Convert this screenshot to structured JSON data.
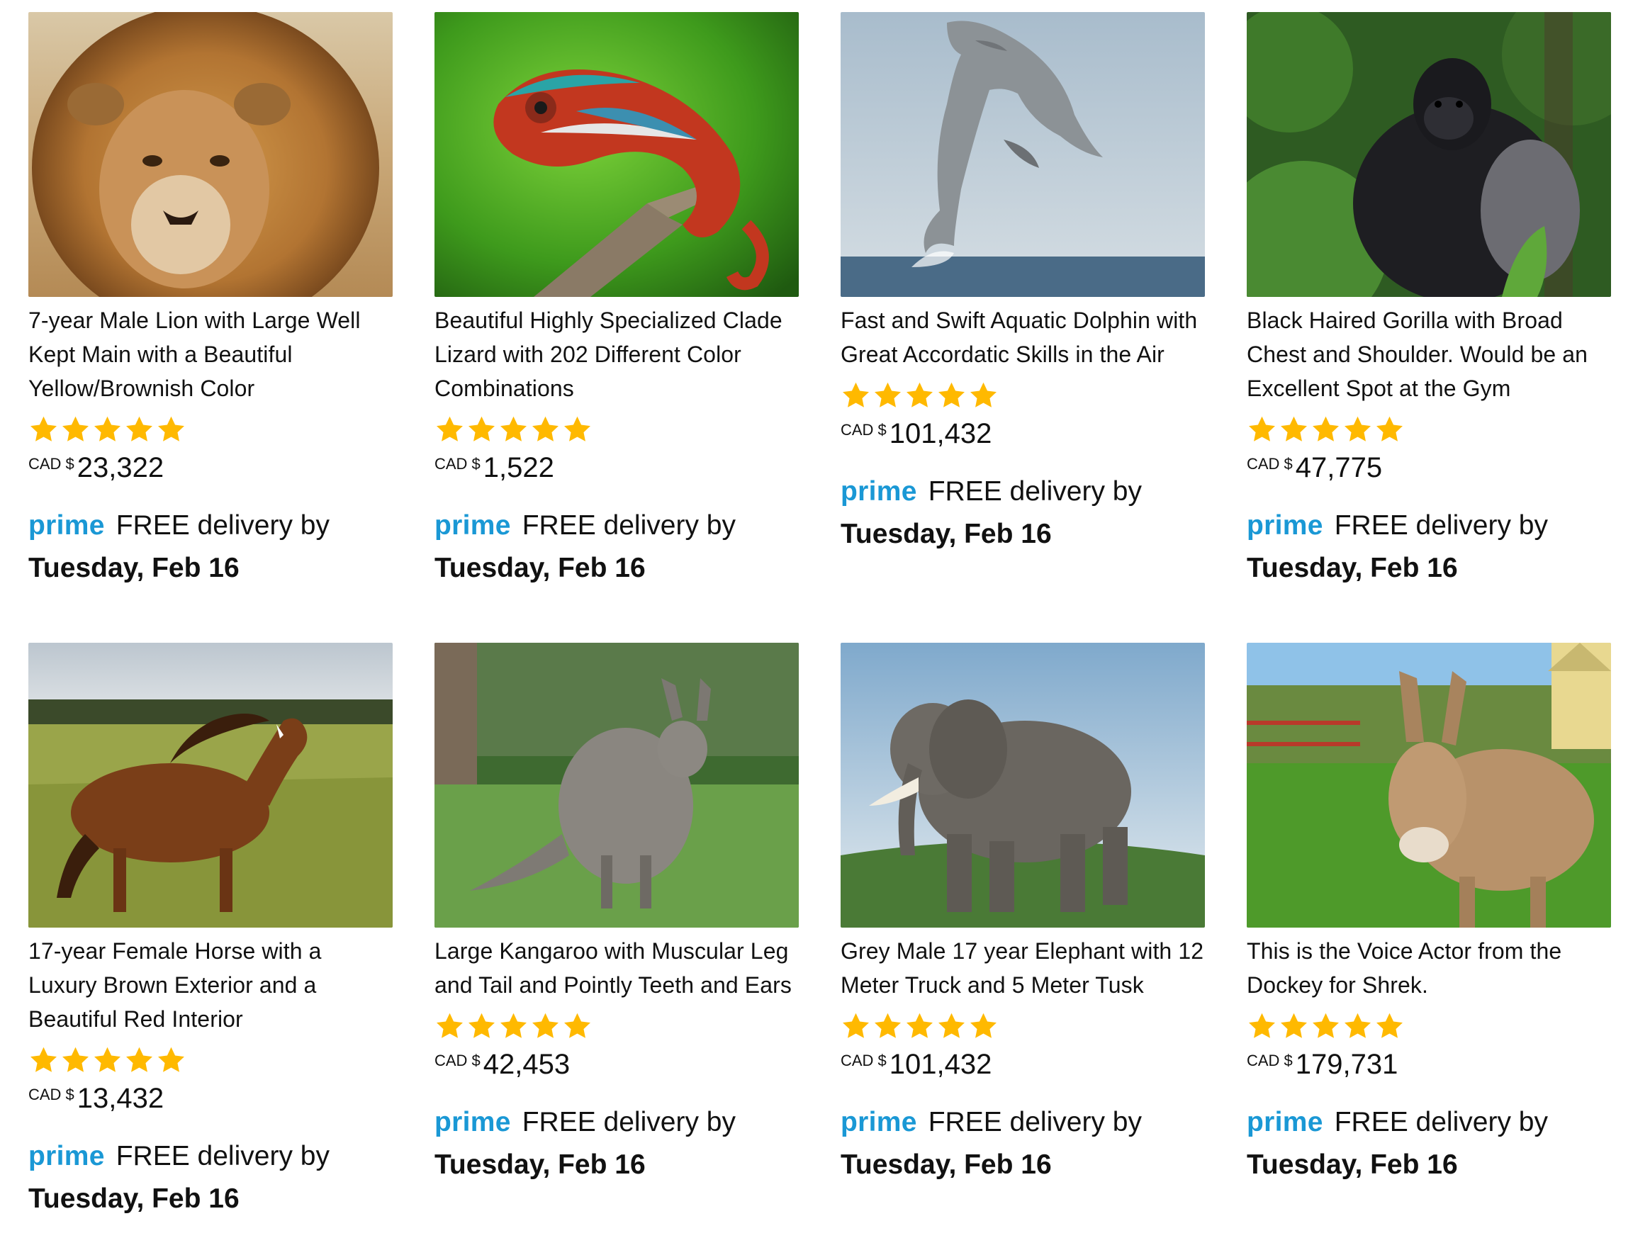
{
  "colors": {
    "prime_blue": "#1a98d5",
    "star_gold": "#ffb900",
    "text": "#111111"
  },
  "icons": {
    "rating": "star-icon"
  },
  "products": [
    {
      "image_alt": "lion",
      "title": "7-year Male Lion with Large Well Kept Main with a Beautiful Yellow/Brownish Color",
      "rating": 5,
      "currency": "CAD $",
      "price": "23,322",
      "prime": "prime",
      "delivery_text": "FREE delivery by",
      "delivery_date": "Tuesday, Feb 16"
    },
    {
      "image_alt": "chameleon",
      "title": "Beautiful Highly Specialized Clade Lizard with 202 Different Color Combinations",
      "rating": 5,
      "currency": "CAD $",
      "price": "1,522",
      "prime": "prime",
      "delivery_text": "FREE delivery by",
      "delivery_date": "Tuesday, Feb 16"
    },
    {
      "image_alt": "dolphin",
      "title": "Fast and Swift Aquatic Dolphin with Great Accordatic Skills in the Air",
      "rating": 5,
      "currency": "CAD $",
      "price": "101,432",
      "prime": "prime",
      "delivery_text": "FREE delivery by",
      "delivery_date": "Tuesday, Feb 16"
    },
    {
      "image_alt": "gorilla",
      "title": "Black Haired Gorilla with Broad Chest and Shoulder. Would be an Excellent Spot at the Gym",
      "rating": 5,
      "currency": "CAD $",
      "price": "47,775",
      "prime": "prime",
      "delivery_text": "FREE delivery by",
      "delivery_date": "Tuesday, Feb 16"
    },
    {
      "image_alt": "horse",
      "title": "17-year Female Horse with a Luxury Brown Exterior and a Beautiful Red Interior",
      "rating": 5,
      "currency": "CAD $",
      "price": "13,432",
      "prime": "prime",
      "delivery_text": "FREE delivery by",
      "delivery_date": "Tuesday, Feb 16"
    },
    {
      "image_alt": "kangaroo",
      "title": "Large Kangaroo with Muscular Leg and Tail and Pointly Teeth and Ears",
      "rating": 5,
      "currency": "CAD $",
      "price": "42,453",
      "prime": "prime",
      "delivery_text": "FREE delivery by",
      "delivery_date": "Tuesday, Feb 16"
    },
    {
      "image_alt": "elephant",
      "title": "Grey Male 17 year Elephant with 12 Meter Truck and 5 Meter Tusk",
      "rating": 5,
      "currency": "CAD $",
      "price": "101,432",
      "prime": "prime",
      "delivery_text": "FREE delivery by",
      "delivery_date": "Tuesday, Feb 16"
    },
    {
      "image_alt": "donkey",
      "title": "This is the Voice Actor from the Dockey for Shrek.",
      "rating": 5,
      "currency": "CAD $",
      "price": "179,731",
      "prime": "prime",
      "delivery_text": "FREE delivery by",
      "delivery_date": "Tuesday, Feb 16"
    }
  ]
}
